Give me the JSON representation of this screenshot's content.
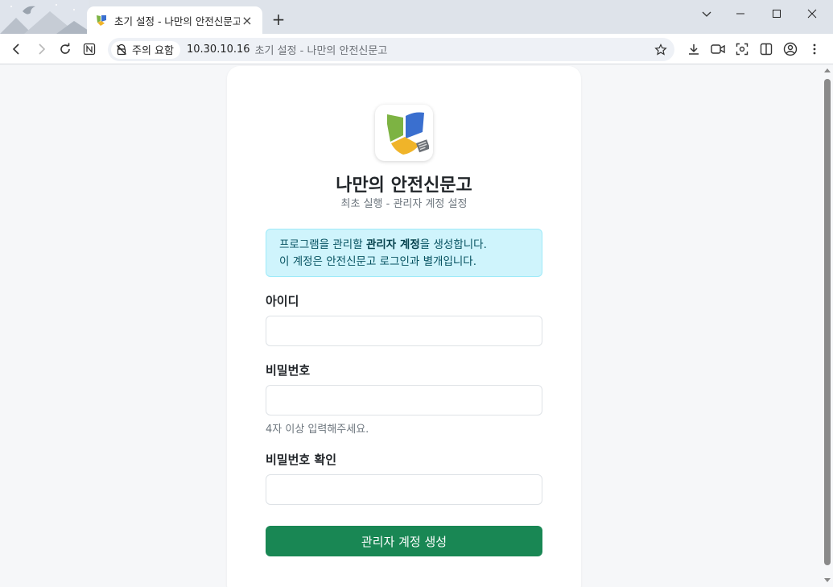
{
  "browser": {
    "tab_title": "초기 설정 - 나만의 안전신문고",
    "new_tab_label": "+",
    "security_chip": "주의 요함",
    "url_host": "10.30.10.16",
    "url_page_title": "초기 설정 - 나만의 안전신문고",
    "icons": [
      "back-icon",
      "forward-icon",
      "reload-icon",
      "n-extension-icon",
      "not-secure-icon",
      "bookmark-star-icon",
      "download-icon",
      "camera-icon",
      "screenshot-icon",
      "split-view-icon",
      "profile-icon",
      "menu-icon",
      "minimize-icon",
      "maximize-icon",
      "close-icon",
      "tab-list-icon"
    ]
  },
  "page": {
    "app_title": "나만의 안전신문고",
    "app_subtitle": "최초 실행 - 관리자 계정 설정",
    "notice": {
      "line1_prefix": "프로그램을 관리할 ",
      "line1_bold": "관리자 계정",
      "line1_suffix": "을 생성합니다.",
      "line2": "이 계정은 안전신문고 로그인과 별개입니다."
    },
    "fields": {
      "username_label": "아이디",
      "username_value": "",
      "password_label": "비밀번호",
      "password_value": "",
      "password_help": "4자 이상 입력해주세요.",
      "confirm_label": "비밀번호 확인",
      "confirm_value": ""
    },
    "submit_label": "관리자 계정 생성"
  },
  "colors": {
    "submit_bg": "#198754",
    "notice_bg": "#cff4fc",
    "notice_border": "#9eeaf9",
    "notice_text": "#055160"
  }
}
